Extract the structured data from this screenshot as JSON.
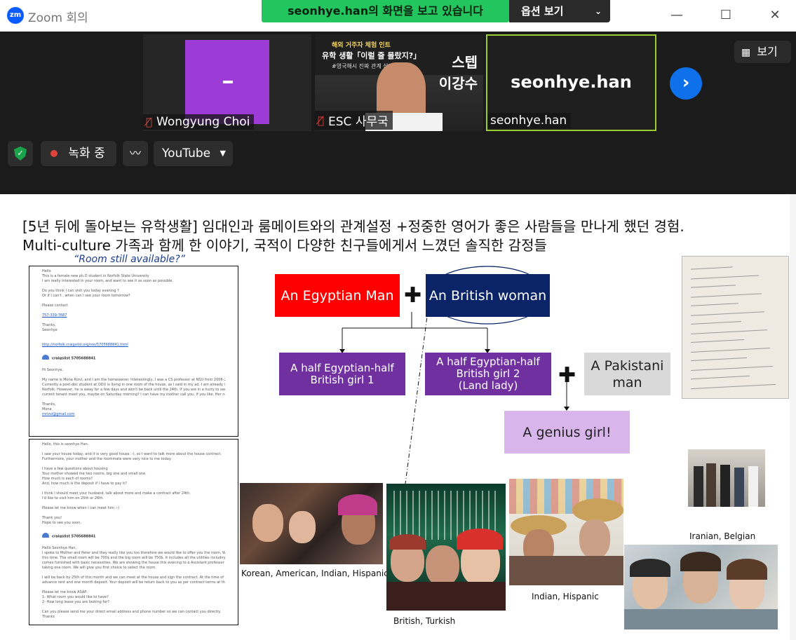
{
  "window": {
    "app_logo": "zm",
    "title": "Zoom 회의",
    "share_banner": "seonhye.han의 화면을 보고 있습니다",
    "view_options": "옵션 보기",
    "minimize": "—",
    "maximize": "☐",
    "close": "✕"
  },
  "participants": [
    {
      "name": "Wongyung Choi",
      "muted": true
    },
    {
      "name": "ESC 사무국",
      "muted": true
    },
    {
      "name": "seonhye.han",
      "muted": false
    }
  ],
  "tile2_poster": {
    "line1": "해외 거주자 체험 인트",
    "line2": "유학 생활「이럴 줄 몰랐지?」",
    "line3": "#영국해시 진짜 관계 삼자",
    "right1": "스텝",
    "right2": "이강수"
  },
  "tile3_center_name": "seonhye.han",
  "view_button": "보기",
  "controls": {
    "recording": "녹화 중",
    "stream_target": "YouTube"
  },
  "slide": {
    "title_line1": "[5년 뒤에 돌아보는 유학생활]  임대인과 룸메이트와의 관계설정 +정중한 영어가 좋은 사람들을 만나게 했던 경험.",
    "title_line2": "Multi-culture 가족과 함께 한 이야기, 국적이 다양한 친구들에게서 느꼈던 솔직한 감정들",
    "email_caption": "“Room still available?”",
    "family_tree": {
      "egyptian_man": "An Egyptian Man",
      "british_woman": "An British woman",
      "girl1": [
        "A half Egyptian-half",
        "British girl 1"
      ],
      "girl2": [
        "A half Egyptian-half",
        "British girl 2",
        "(Land lady)"
      ],
      "pakistani_man": [
        "A Pakistani",
        "man"
      ],
      "genius_girl": "A genius girl!",
      "plus": "✚"
    },
    "photo_labels": {
      "p1": "Korean, American, Indian, Hispanic",
      "p2": "British, Turkish",
      "p3": "Indian, Hispanic",
      "p4": "Iranian, Belgian"
    },
    "email1": {
      "lines": [
        "Hello",
        "This is a female new ph.D student in Norfolk State University",
        "I am really interested in your room, and want to see it as soon as possible.",
        "",
        "Do you think I can visit you today evening ?",
        "Or if I can't , when can I see your room tomorrow?",
        "",
        "Please contact",
        "",
        "757-339-7687",
        "",
        "Thanks,",
        "Seonhye",
        "",
        "",
        "http://norfolk.craigslist.org/roo/5705688841.html"
      ],
      "sender": "craigslist 5705688841",
      "reply_lines": [
        "Hi Seonhye,",
        "",
        "My name is Mona Rizvi, and I am the homeowner.  Interestingly, I was a CS professor at NSU from 2006-2013.  Now I teach in Kazakhstan.",
        "Currently a post-doc student at ODU is living in one room of the house, as I said in my ad.  I am already in Kazakhstan, but my husband is still in",
        "Norfolk.  However, he is away for a few days and won't be back until the 24th.  If you are in a hurry to see the room, I can have my mother and the",
        "current tenant meet you, maybe on Saturday morning?  I can have my mother call you, if you like.  Her name is Mary El Kadi.",
        "",
        "Thanks,",
        "Mona",
        "mrizvi@gmail.com"
      ]
    },
    "email2": {
      "lines": [
        "Hello, this is seonhye Han.",
        "",
        "I saw your house today, and it is very good house :-), so I want to talk more about the house contract.",
        "Furthermore, your mother and the roommate were very nice to me today.",
        "",
        "I have a few questions about housing",
        "Your mother showed me two rooms, big one and small one.",
        "How much is each of rooms?",
        "And, how much is the deposit if I have to pay it?",
        "",
        "I think I should meet your husband, talk about more and make a contract after 24th.",
        "I'd like to visit him on 25th or 26th.",
        "",
        "Please let me know when I can meet him :-)",
        "",
        "Thank you!",
        "Hope to see you soon,"
      ],
      "sender": "craigslist 5705688841",
      "reply_lines": [
        "Hello Seonhye Han,",
        "I spoke to Mother and Peter and they really like you too therefore we would like to offer you the room. We have two rooms available at",
        "this time. The small room will be 700$ and the big room will be 750$. It includes all the utilities including high speed internet. The room",
        "comes furnished with basic necessities. We are showing the house this evening to a Assistant professor of ODU who is also interested",
        "taking one room. We will give you first choice to select the room.",
        "",
        "I will be back by 25th of this month and we can meet at the house and sign the contract. At the time of contract we will need one month",
        "advance rent and one month deposit. Your deposit will be return back to you as per contract terms at the end of the lease.",
        "",
        "Please let me know ASAP:",
        "1- What room you would like to have?",
        "2- How long lease you are looking for?",
        "",
        "Can you please send me your direct email address and phone number so we can contact you directly.",
        "Thanks"
      ]
    }
  },
  "colors": {
    "share_green": "#22c55e",
    "egyptian_red": "#ff0000",
    "british_navy": "#0b2468",
    "girl_purple": "#7030a0",
    "pakistani_grey": "#d9d9d9",
    "genius_lavender": "#d8b6ec"
  }
}
